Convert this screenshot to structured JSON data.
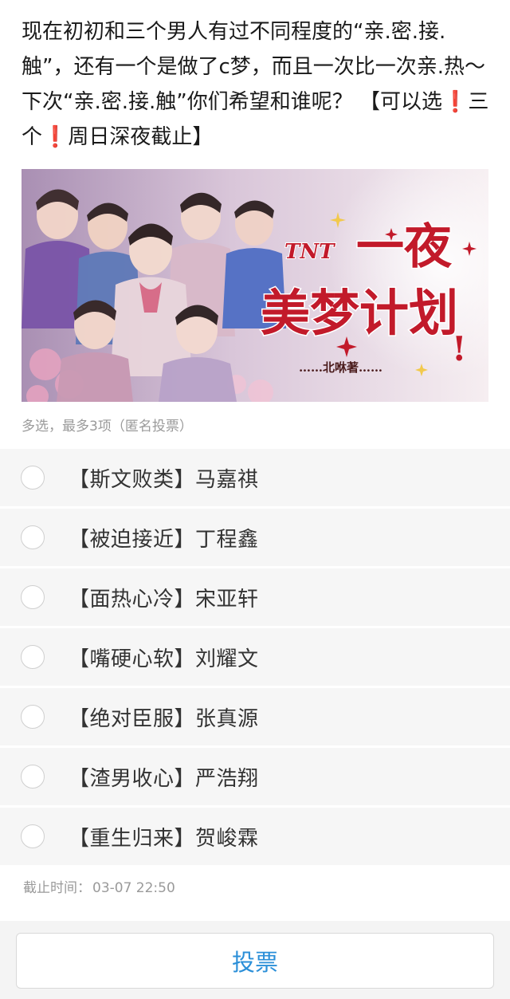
{
  "question": {
    "part1": "现在初初和三个男人有过不同程度的“亲.密.接.触”，还有一个是做了c梦，而且一次比一次亲.热～ 下次“亲.密.接.触”你们希望和谁呢？ 【可以选",
    "bang1": "❗",
    "part2": "三个",
    "bang2": "❗",
    "part3": "周日深夜截止】"
  },
  "banner": {
    "brand": "TNT",
    "title_line1": "一夜",
    "title_line2": "美梦计划",
    "exclaim": "!",
    "author": "……北咻著……",
    "colors": {
      "title": "#c21a2a",
      "shadow": "#ffffff"
    }
  },
  "vote_note": "多选，最多3项（匿名投票）",
  "options": [
    {
      "label": "【斯文败类】马嘉祺",
      "selected": false
    },
    {
      "label": "【被迫接近】丁程鑫",
      "selected": false
    },
    {
      "label": "【面热心冷】宋亚轩",
      "selected": false
    },
    {
      "label": "【嘴硬心软】刘耀文",
      "selected": false
    },
    {
      "label": "【绝对臣服】张真源",
      "selected": false
    },
    {
      "label": "【渣男收心】严浩翔",
      "selected": false
    },
    {
      "label": "【重生归来】贺峻霖",
      "selected": false
    }
  ],
  "deadline": {
    "label": "截止时间：",
    "value": "03-07 22:50"
  },
  "vote_button": {
    "label": "投票",
    "color": "#2b8fd8"
  }
}
